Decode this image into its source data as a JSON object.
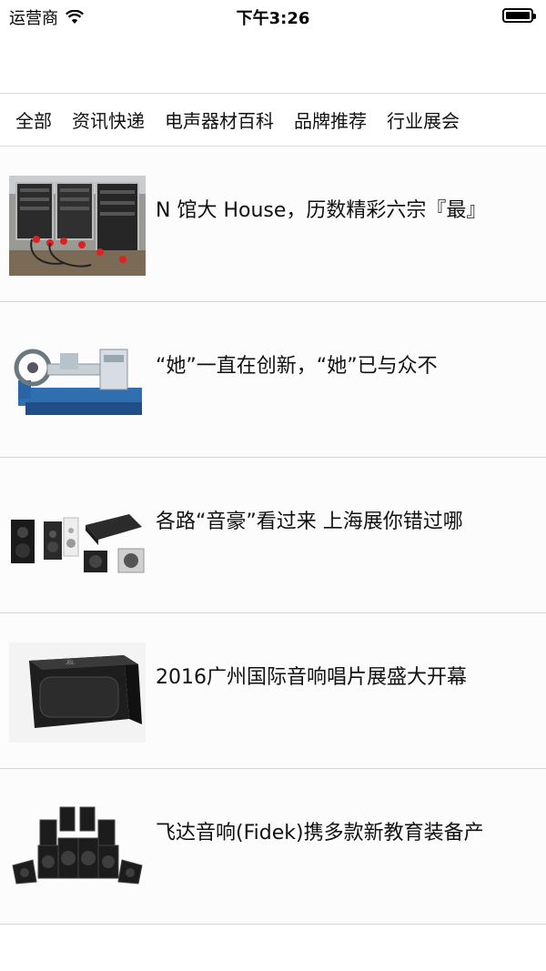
{
  "status_bar": {
    "carrier": "运营商",
    "time": "下午3:26"
  },
  "tabs": [
    "全部",
    "资讯快递",
    "电声器材百科",
    "品牌推荐",
    "行业展会"
  ],
  "articles": [
    {
      "title": "N 馆大 House，历数精彩六宗『最』",
      "thumb": "equipment-racks-image"
    },
    {
      "title": "“她”一直在创新，“她”已与众不",
      "thumb": "lathe-machine-image"
    },
    {
      "title": "各路“音豪”看过来 上海展你错过哪",
      "thumb": "speakers-mixer-image"
    },
    {
      "title": "2016广州国际音响唱片展盛大开幕",
      "thumb": "karaoke-speaker-image"
    },
    {
      "title": "飞达音响(Fidek)携多款新教育装备产",
      "thumb": "speaker-array-image"
    }
  ]
}
